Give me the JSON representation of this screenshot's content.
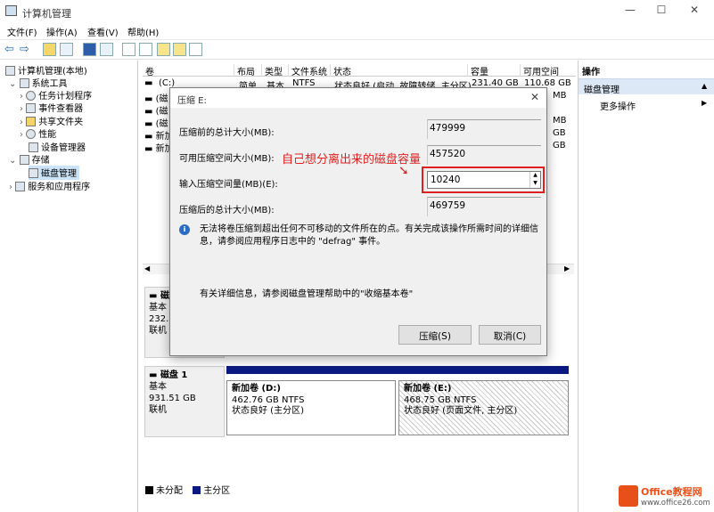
{
  "window": {
    "title": "计算机管理"
  },
  "menu": [
    "文件(F)",
    "操作(A)",
    "查看(V)",
    "帮助(H)"
  ],
  "tree": {
    "root": "计算机管理(本地)",
    "system_tools": "系统工具",
    "task_scheduler": "任务计划程序",
    "event_viewer": "事件查看器",
    "shared_folders": "共享文件夹",
    "performance": "性能",
    "device_manager": "设备管理器",
    "storage": "存储",
    "disk_management": "磁盘管理",
    "services_apps": "服务和应用程序"
  },
  "table": {
    "columns": [
      "卷",
      "布局",
      "类型",
      "文件系统",
      "状态",
      "容量",
      "可用空间"
    ],
    "rows": [
      {
        "vol": "(C:)",
        "layout": "简单",
        "type": "基本",
        "fs": "NTFS",
        "status": "状态良好 (启动, 故障转储, 主分区)",
        "cap": "231.40 GB",
        "free": "110.68 GB"
      },
      {
        "vol": "(磁",
        "free": "MB"
      },
      {
        "vol": "(磁",
        "free": ""
      },
      {
        "vol": "(磁",
        "free": "MB"
      },
      {
        "vol": "新加",
        "free": "GB"
      },
      {
        "vol": "新加",
        "free": "GB"
      }
    ]
  },
  "actions": {
    "header": "操作",
    "section": "磁盘管理",
    "more": "更多操作"
  },
  "dialog": {
    "title": "压缩 E:",
    "total_before_label": "压缩前的总计大小(MB):",
    "total_before": "479999",
    "available_label": "可用压缩空间大小(MB):",
    "available": "457520",
    "input_label": "输入压缩空间量(MB)(E):",
    "input_value": "10240",
    "total_after_label": "压缩后的总计大小(MB):",
    "total_after": "469759",
    "info": "无法将卷压缩到超出任何不可移动的文件所在的点。有关完成该操作所需时间的详细信息，请参阅应用程序日志中的 \"defrag\" 事件。",
    "help": "有关详细信息，请参阅磁盘管理帮助中的\"收缩基本卷\"",
    "compress_btn": "压缩(S)",
    "cancel_btn": "取消(C)"
  },
  "annotation": "自己想分离出来的磁盘容量",
  "disk0": {
    "name": "磁",
    "type": "基本",
    "size": "232.8",
    "status": "联机"
  },
  "disk1": {
    "name": "磁盘 1",
    "type": "基本",
    "size": "931.51 GB",
    "status": "联机",
    "vol_d": {
      "name": "新加卷 (D:)",
      "size": "462.76 GB NTFS",
      "status": "状态良好 (主分区)"
    },
    "vol_e": {
      "name": "新加卷 (E:)",
      "size": "468.75 GB NTFS",
      "status": "状态良好 (页面文件, 主分区)"
    }
  },
  "legend": {
    "unallocated": "未分配",
    "primary": "主分区"
  },
  "watermark": {
    "brand": "Office教程网",
    "url": "www.office26.com"
  }
}
